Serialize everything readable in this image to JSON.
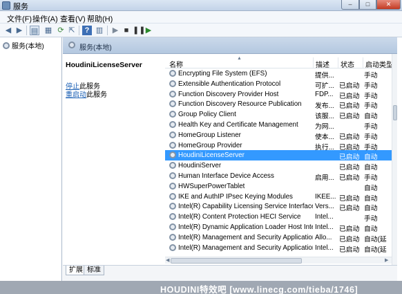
{
  "window": {
    "title": "服务",
    "minimize": "–",
    "maximize": "□",
    "close": "✕"
  },
  "menu": [
    "文件(F)",
    "操作(A)",
    "查看(V)",
    "帮助(H)"
  ],
  "toolbar_icons": [
    "back-arrow-icon",
    "forward-arrow-icon",
    "console-tree-icon",
    "properties-icon",
    "refresh-icon",
    "export-icon",
    "help-icon",
    "view-icon",
    "play-icon",
    "stop-icon",
    "pause-icon",
    "restart-icon"
  ],
  "tree": {
    "root_label": "服务(本地)"
  },
  "panel": {
    "header_label": "服务(本地)"
  },
  "description": {
    "service_name": "HoudiniLicenseServer",
    "stop_link": "停止",
    "stop_suffix": "此服务",
    "restart_link": "重启动",
    "restart_suffix": "此服务"
  },
  "columns": [
    "名称",
    "描述",
    "状态",
    "启动类型"
  ],
  "rows": [
    {
      "name": "Encrypting File System (EFS)",
      "desc": "提供...",
      "status": "",
      "start": "手动"
    },
    {
      "name": "Extensible Authentication Protocol",
      "desc": "可扩...",
      "status": "已启动",
      "start": "手动"
    },
    {
      "name": "Function Discovery Provider Host",
      "desc": "FDP...",
      "status": "已启动",
      "start": "手动"
    },
    {
      "name": "Function Discovery Resource Publication",
      "desc": "发布...",
      "status": "已启动",
      "start": "手动"
    },
    {
      "name": "Group Policy Client",
      "desc": "该服...",
      "status": "已启动",
      "start": "自动"
    },
    {
      "name": "Health Key and Certificate Management",
      "desc": "为网...",
      "status": "",
      "start": "手动"
    },
    {
      "name": "HomeGroup Listener",
      "desc": "使本...",
      "status": "已启动",
      "start": "手动"
    },
    {
      "name": "HomeGroup Provider",
      "desc": "执行...",
      "status": "已启动",
      "start": "手动"
    },
    {
      "name": "HoudiniLicenseServer",
      "desc": "",
      "status": "已启动",
      "start": "自动"
    },
    {
      "name": "HoudiniServer",
      "desc": "",
      "status": "已启动",
      "start": "自动"
    },
    {
      "name": "Human Interface Device Access",
      "desc": "启用...",
      "status": "已启动",
      "start": "手动"
    },
    {
      "name": "HWSuperPowerTablet",
      "desc": "",
      "status": "",
      "start": "自动"
    },
    {
      "name": "IKE and AuthIP IPsec Keying Modules",
      "desc": "IKEE...",
      "status": "已启动",
      "start": "自动"
    },
    {
      "name": "Intel(R) Capability Licensing Service Interface",
      "desc": "Vers...",
      "status": "已启动",
      "start": "自动"
    },
    {
      "name": "Intel(R) Content Protection HECI Service",
      "desc": "Intel...",
      "status": "",
      "start": "手动"
    },
    {
      "name": "Intel(R) Dynamic Application Loader Host Inte...",
      "desc": "Intel...",
      "status": "已启动",
      "start": "自动"
    },
    {
      "name": "Intel(R) Management and Security Application...",
      "desc": "Allo...",
      "status": "已启动",
      "start": "自动(延"
    },
    {
      "name": "Intel(R) Management and Security Application...",
      "desc": "Intel...",
      "status": "已启动",
      "start": "自动(延"
    }
  ],
  "selected_row": "HoudiniLicenseServer",
  "tabs": [
    "扩展",
    "标准"
  ],
  "watermark": "HOUDINI特效吧 [www.linecg.com/tieba/1746]"
}
